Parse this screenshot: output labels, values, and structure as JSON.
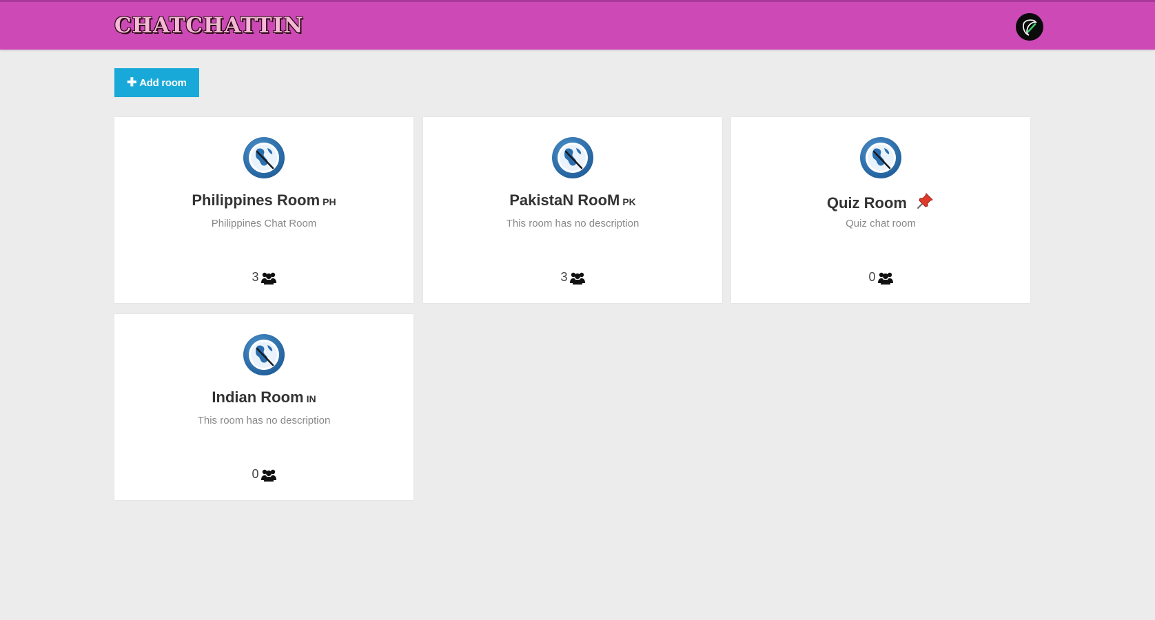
{
  "header": {
    "logo_text": "CHATCHATTIN",
    "brand_color": "#cc49b6",
    "avatar_icon": "leaf-logo-icon"
  },
  "toolbar": {
    "add_room_label": "Add room",
    "add_room_icon": "plus-icon",
    "accent_color": "#19a9d8"
  },
  "rooms": [
    {
      "name": "Philippines Room",
      "code": "PH",
      "description": "Philippines Chat Room",
      "users": "3",
      "icon": "globe-icon"
    },
    {
      "name": "PakistaN RooM",
      "code": "PK",
      "description": "This room has no description",
      "users": "3",
      "icon": "globe-icon"
    },
    {
      "name": "Quiz Room",
      "code": "",
      "description": "Quiz chat room",
      "users": "0",
      "icon": "globe-icon",
      "badge_icon": "pushpin-icon"
    },
    {
      "name": "Indian Room",
      "code": "IN",
      "description": "This room has no description",
      "users": "0",
      "icon": "globe-icon"
    }
  ]
}
